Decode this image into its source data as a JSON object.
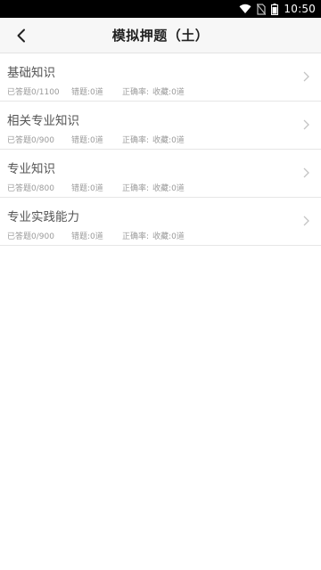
{
  "status_bar": {
    "time": "10:50",
    "icons": [
      "wifi-icon",
      "no-sim-icon",
      "battery-icon"
    ]
  },
  "header": {
    "title": "模拟押题（土）",
    "back_icon": "chevron-left-icon"
  },
  "items": [
    {
      "name": "基础知识",
      "answered": "已答题0/1100",
      "wrong": "错题:0道",
      "correct_rate": "正确率:",
      "favorites": "收藏:0道"
    },
    {
      "name": "相关专业知识",
      "answered": "已答题0/900",
      "wrong": "错题:0道",
      "correct_rate": "正确率:",
      "favorites": "收藏:0道"
    },
    {
      "name": "专业知识",
      "answered": "已答题0/800",
      "wrong": "错题:0道",
      "correct_rate": "正确率:",
      "favorites": "收藏:0道"
    },
    {
      "name": "专业实践能力",
      "answered": "已答题0/900",
      "wrong": "错题:0道",
      "correct_rate": "正确率:",
      "favorites": "收藏:0道"
    }
  ],
  "colors": {
    "status_bar_bg": "#000000",
    "header_bg": "#f7f7f7",
    "item_title": "#555555",
    "item_stats": "#9a9a9a",
    "divider": "#e6e6e6"
  }
}
